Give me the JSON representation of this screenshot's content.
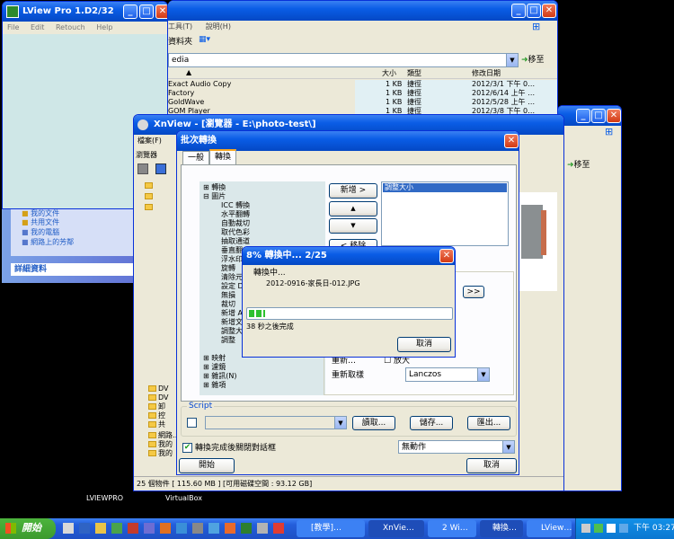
{
  "lview": {
    "title": "LView Pro 1.D2/32",
    "menu": [
      "File",
      "Edit",
      "Retouch",
      "Help"
    ]
  },
  "explorer": {
    "menu": [
      "工具(T)",
      "說明(H)"
    ],
    "folder_btn": "資料夾",
    "address": "edia",
    "go_label": "移至",
    "columns": [
      "大小",
      "類型",
      "修改日期"
    ],
    "files": [
      {
        "name": "Exact Audio Copy",
        "size": "1 KB",
        "type": "捷徑",
        "date": "2012/3/1 下午 0…"
      },
      {
        "name": "Factory",
        "size": "1 KB",
        "type": "捷徑",
        "date": "2012/6/14 上午 …"
      },
      {
        "name": "GoldWave",
        "size": "1 KB",
        "type": "捷徑",
        "date": "2012/5/28 上午 …"
      },
      {
        "name": "GOM Player",
        "size": "1 KB",
        "type": "捷徑",
        "date": "2012/3/8 下午 0…"
      }
    ],
    "side_links": [
      "我的文件",
      "共用文件",
      "我的電腦",
      "網路上的芳鄰"
    ],
    "details_header": "詳細資料"
  },
  "rightwin": {
    "go_label": "移至"
  },
  "xnview": {
    "title": "XnView - [瀏覽器 - E:\\photo-test\\]",
    "menu_item": "檔案(F)",
    "browser_tab": "瀏覽器",
    "status": "25 個物件 [ 115.60 MB ] [可用磁碟空間 : 93.12 GB]",
    "tree_items": [
      "DV",
      "DV",
      "卸",
      "控",
      "共",
      "網路…",
      "我的",
      "我的"
    ]
  },
  "batch": {
    "title": "批次轉換",
    "tabs": [
      "一般",
      "轉換"
    ],
    "ops_tree": [
      "轉換",
      "圖片",
      "ICC 轉換",
      "水平翻轉",
      "自動裁切",
      "取代色彩",
      "抽取通道",
      "垂直翻",
      "浮水印",
      "旋轉",
      "清除元",
      "設定 D",
      "無損",
      "裁切",
      "新增 A",
      "新增文",
      "調整大",
      "調整",
      "映射",
      "濾鏡",
      "雜訊(N)",
      "雜項"
    ],
    "add_btn": "新增 >",
    "up_btn": "▲",
    "down_btn": "▼",
    "remove_btn": "< 移除",
    "selected_op": "調整大小",
    "more_btn": ">>",
    "resample_label": "重新取樣",
    "resample_value": "Lanczos",
    "ratio_text": "重新…",
    "ratio_text2": "放大",
    "script_label": "Script",
    "load_btn": "讀取...",
    "save_btn": "儲存...",
    "export_btn": "匯出...",
    "close_check_label": "轉換完成後關閉對話框",
    "action_value": "無動作",
    "start_btn": "開始",
    "cancel_btn": "取消"
  },
  "progress": {
    "title": "8% 轉換中... 2/25",
    "converting_label": "轉換中...",
    "filename": "2012-0916-家長日-012.JPG",
    "percent": 8,
    "remaining": "38 秒之後完成",
    "cancel_btn": "取消"
  },
  "desktop": {
    "icons": [
      "LVIEWPRO",
      "VirtualBox"
    ]
  },
  "taskbar": {
    "start": "開始",
    "items": [
      "[教學]…",
      "XnVie…",
      "2 Wi…",
      "轉換…",
      "LView…"
    ],
    "clock": "下午 03:27"
  },
  "colors": {
    "xp_blue": "#0a5de6",
    "taskbar": "#245edb",
    "start_green": "#3c9a2d",
    "progress_green": "#2ec12e",
    "dialog_bg": "#ece9d8"
  }
}
